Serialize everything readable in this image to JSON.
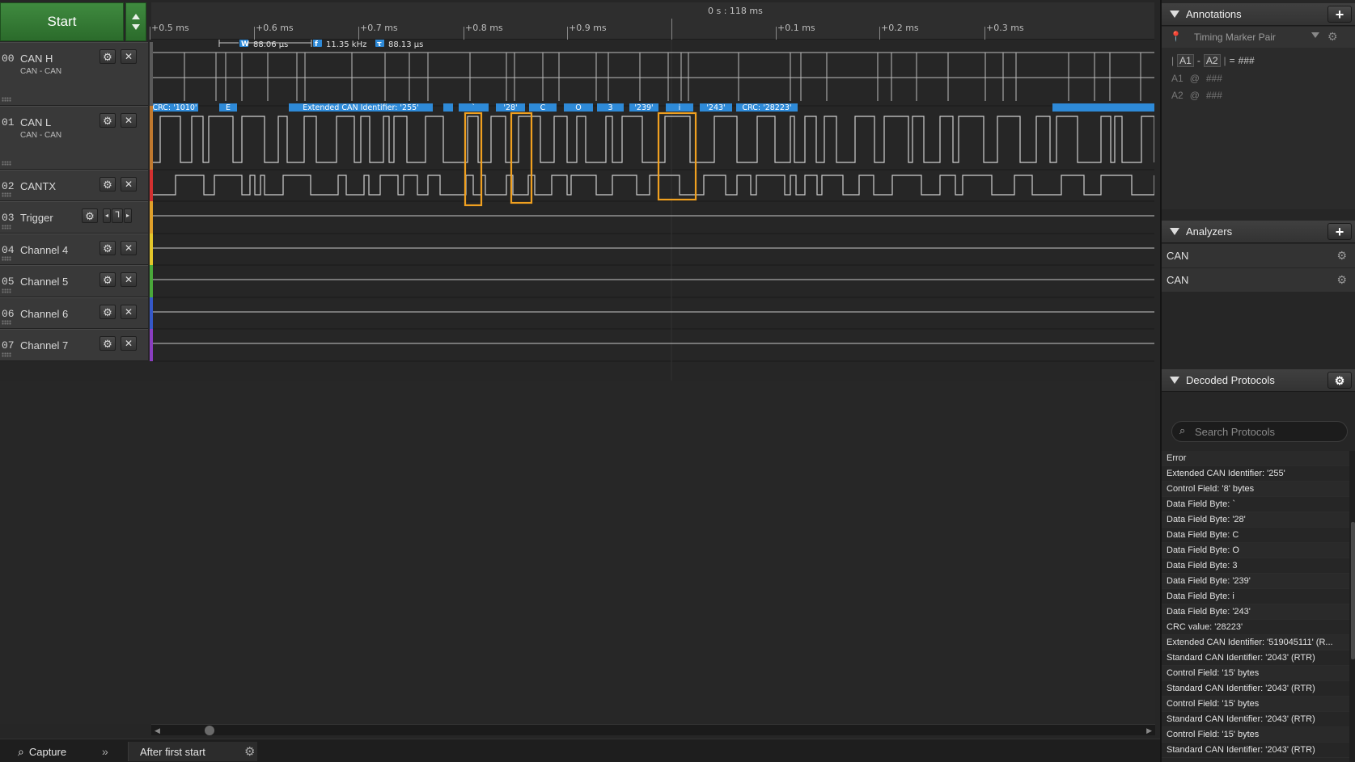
{
  "start_label": "Start",
  "channels": [
    {
      "num": "00",
      "name": "CAN H",
      "sub": "CAN - CAN",
      "color": "#5a5a5a"
    },
    {
      "num": "01",
      "name": "CAN L",
      "sub": "CAN - CAN",
      "color": "#c0792f"
    },
    {
      "num": "02",
      "name": "CANTX",
      "sub": "",
      "color": "#d33030"
    },
    {
      "num": "03",
      "name": "Trigger",
      "sub": "",
      "color": "#e0a02a"
    },
    {
      "num": "04",
      "name": "Channel 4",
      "sub": "",
      "color": "#e4c62a"
    },
    {
      "num": "05",
      "name": "Channel 5",
      "sub": "",
      "color": "#4aa83a"
    },
    {
      "num": "06",
      "name": "Channel 6",
      "sub": "",
      "color": "#3558c8"
    },
    {
      "num": "07",
      "name": "Channel 7",
      "sub": "",
      "color": "#8a3ec0"
    }
  ],
  "ruler": {
    "center_label": "0 s : 118 ms",
    "ticks": [
      "+0.5 ms",
      "+0.6 ms",
      "+0.7 ms",
      "+0.8 ms",
      "+0.9 ms",
      "+0.1 ms",
      "+0.2 ms",
      "+0.3 ms"
    ]
  },
  "measure": {
    "width_icon": "W",
    "width_value": "88.06 µs",
    "freq_icon": "f",
    "freq_value": "11.35 kHz",
    "period_icon": "τ",
    "period_value": "88.13 µs"
  },
  "decode_labels": [
    "CRC: '1010'",
    "E",
    "Extended CAN Identifier: '255'",
    "",
    "`",
    "'28'",
    "C",
    "O",
    "3",
    "'239'",
    "i",
    "'243'",
    "CRC: '28223'",
    ""
  ],
  "annotations": {
    "title": "Annotations",
    "marker_pair": "Timing Marker Pair",
    "formula": {
      "a1": "A1",
      "minus": "-",
      "a2": "A2",
      "equals": "=",
      "value": "###"
    },
    "a1_row": {
      "label": "A1",
      "at": "@",
      "value": "###"
    },
    "a2_row": {
      "label": "A2",
      "at": "@",
      "value": "###"
    }
  },
  "analyzers": {
    "title": "Analyzers",
    "items": [
      "CAN",
      "CAN"
    ]
  },
  "decoded": {
    "title": "Decoded Protocols",
    "search_placeholder": "Search Protocols",
    "items": [
      "Error",
      "Extended CAN Identifier: '255'",
      "Control Field: '8' bytes",
      "Data Field Byte: `",
      "Data Field Byte: '28'",
      "Data Field Byte: C",
      "Data Field Byte: O",
      "Data Field Byte: 3",
      "Data Field Byte: '239'",
      "Data Field Byte: i",
      "Data Field Byte: '243'",
      "CRC value: '28223'",
      "Extended CAN Identifier: '519045111' (R...",
      "Standard CAN Identifier: '2043' (RTR)",
      "Control Field: '15' bytes",
      "Standard CAN Identifier: '2043' (RTR)",
      "Control Field: '15' bytes",
      "Standard CAN Identifier: '2043' (RTR)",
      "Control Field: '15' bytes",
      "Standard CAN Identifier: '2043' (RTR)"
    ]
  },
  "status": {
    "capture_label": "Capture",
    "trigger_label": "After first start"
  },
  "colors": {
    "accent_blue": "#2e8ad8",
    "highlight_orange": "#f0a020",
    "start_green": "#3f8a3f"
  }
}
